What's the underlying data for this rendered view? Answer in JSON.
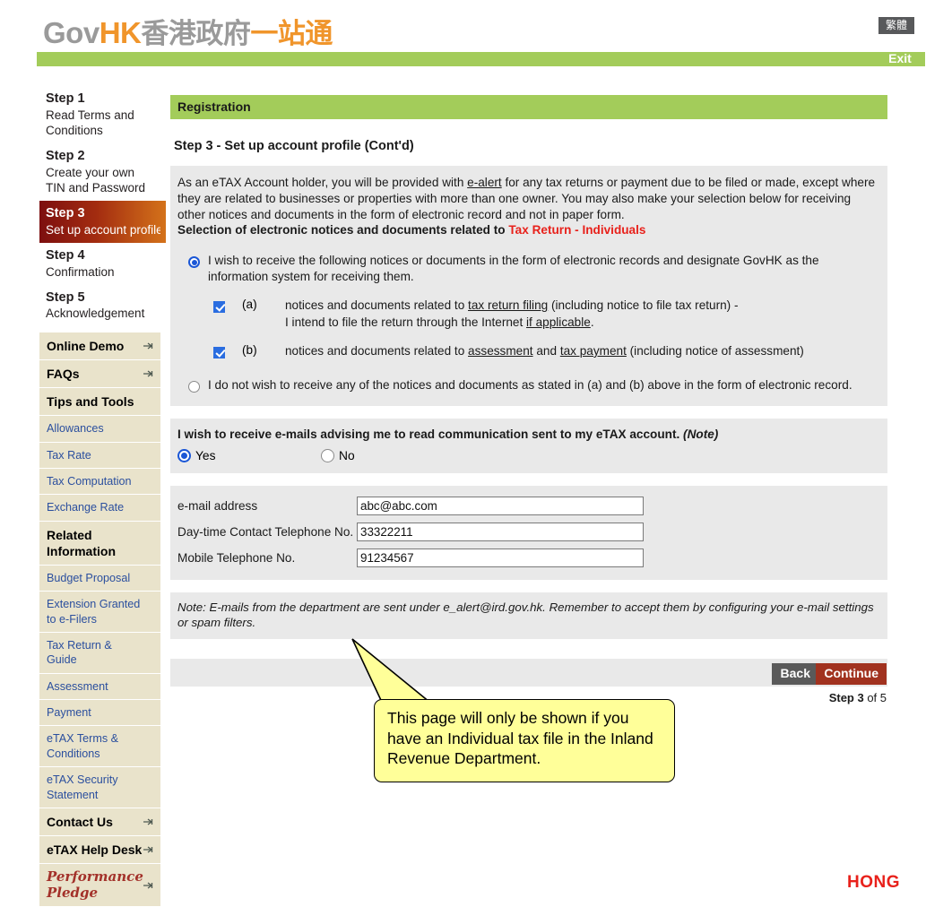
{
  "header": {
    "logo": {
      "gov": "Gov",
      "hk": "HK",
      "cn_gray": "香港政府",
      "cn_orange": "一站通"
    },
    "lang_button": "繁體",
    "exit_button": "Exit"
  },
  "sidebar": {
    "steps": [
      {
        "title": "Step 1",
        "subtitle": "Read Terms and Conditions",
        "active": false
      },
      {
        "title": "Step 2",
        "subtitle": "Create your own TIN and Password",
        "active": false
      },
      {
        "title": "Step 3",
        "subtitle": "Set up account profile",
        "active": true
      },
      {
        "title": "Step 4",
        "subtitle": "Confirmation",
        "active": false
      },
      {
        "title": "Step 5",
        "subtitle": "Acknowledgement",
        "active": false
      }
    ],
    "menu": [
      {
        "label": "Online Demo",
        "type": "header",
        "arrow": true
      },
      {
        "label": "FAQs",
        "type": "header",
        "arrow": true
      },
      {
        "label": "Tips and Tools",
        "type": "header",
        "arrow": false
      },
      {
        "label": "Allowances",
        "type": "link",
        "arrow": false
      },
      {
        "label": "Tax Rate",
        "type": "link",
        "arrow": false
      },
      {
        "label": "Tax Computation",
        "type": "link",
        "arrow": false
      },
      {
        "label": "Exchange Rate",
        "type": "link",
        "arrow": false
      },
      {
        "label": "Related Information",
        "type": "header",
        "arrow": false
      },
      {
        "label": "Budget Proposal",
        "type": "link",
        "arrow": false
      },
      {
        "label": "Extension Granted to e-Filers",
        "type": "link",
        "arrow": false
      },
      {
        "label": "Tax Return & Guide",
        "type": "link",
        "arrow": false
      },
      {
        "label": "Assessment",
        "type": "link",
        "arrow": false
      },
      {
        "label": "Payment",
        "type": "link",
        "arrow": false
      },
      {
        "label": "eTAX Terms & Conditions",
        "type": "link",
        "arrow": false
      },
      {
        "label": "eTAX Security Statement",
        "type": "link",
        "arrow": false
      },
      {
        "label": "Contact Us",
        "type": "header",
        "arrow": true
      },
      {
        "label": "eTAX Help Desk",
        "type": "header",
        "arrow": true
      },
      {
        "label": "Performance Pledge",
        "type": "pledge",
        "arrow": true
      }
    ]
  },
  "main": {
    "section_bar": "Registration",
    "step_title": "Step 3 - Set up account profile (Cont'd)",
    "intro": {
      "part1": "As an eTAX Account holder, you will be provided with ",
      "link1": "e-alert",
      "part2": " for any tax returns or payment due to be filed or made, except where they are related to businesses or properties with more than one owner. You may also make your selection below for receiving other notices and documents in the form of electronic record and not in paper form."
    },
    "selection_heading": {
      "text": "Selection of electronic notices and documents related to ",
      "highlight": "Tax Return - Individuals"
    },
    "option_yes": {
      "selected": true,
      "text": "I wish to receive the following notices or documents in the form of electronic records and designate GovHK as the information system for receiving them."
    },
    "sub_a": {
      "checked": true,
      "marker": "(a)",
      "line1_p1": "notices and documents related to ",
      "line1_link": "tax return filing",
      "line1_p2": " (including notice to file tax return) -",
      "line2_p1": "I intend to file the return through the Internet ",
      "line2_link": "if applicable",
      "line2_p2": "."
    },
    "sub_b": {
      "checked": true,
      "marker": "(b)",
      "p1": "notices and documents related to ",
      "link1": "assessment",
      "p2": " and ",
      "link2": "tax payment",
      "p3": " (including notice of assessment)"
    },
    "option_no": {
      "selected": false,
      "text": "I do not wish to receive any of the notices and documents as stated in (a) and (b) above in the form of electronic record."
    },
    "email_pref": {
      "question": "I wish to receive e-mails advising me to read communication sent to my eTAX account. ",
      "note_tag": "(Note)",
      "yes_label": "Yes",
      "no_label": "No",
      "selected": "Yes"
    },
    "fields": [
      {
        "label": "e-mail address",
        "value": "abc@abc.com"
      },
      {
        "label": "Day-time Contact Telephone No.",
        "value": "33322211"
      },
      {
        "label": "Mobile Telephone No.",
        "value": "91234567"
      }
    ],
    "note": "Note: E-mails from the department are sent under e_alert@ird.gov.hk. Remember to accept them by configuring your e-mail settings or spam filters.",
    "back_button": "Back",
    "continue_button": "Continue",
    "step_counter": {
      "current": "Step 3",
      "of": " of 5"
    }
  },
  "callout": {
    "text": "This page will only be shown if you have an Individual tax file in the Inland Revenue Department."
  },
  "footer": {
    "logo_fragment": "HONG"
  },
  "colors": {
    "green": "#a3cc5a",
    "orange": "#f0952b",
    "red_accent": "#e8211b",
    "continue_red": "#a1321f",
    "sidebar_beige": "#e9e3cb",
    "link_blue": "#2b4f9e",
    "panel_gray": "#e9e9e9",
    "callout_yellow": "#ffff99"
  }
}
